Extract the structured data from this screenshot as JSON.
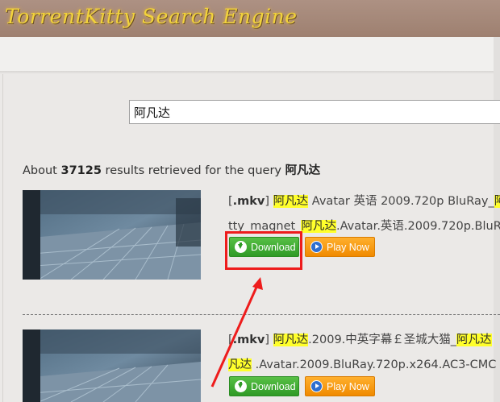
{
  "header": {
    "logo": "TorrentKitty Search Engine"
  },
  "search": {
    "query": "阿凡达"
  },
  "summary": {
    "prefix": "About ",
    "count": "37125",
    "middle": " results retrieved for the query ",
    "query": "阿凡达"
  },
  "results": [
    {
      "ext": ".mkv",
      "title": {
        "a": "[",
        "b": "] ",
        "c": "阿凡达",
        "d": " Avatar 英语 2009.720p BluRay_",
        "e": "阿"
      },
      "magnet": {
        "a": "tty_magnet_",
        "b": "阿凡达",
        "c": ".Avatar.英语.2009.720p.BluR"
      },
      "download_label": "Download",
      "play_label": "Play Now"
    },
    {
      "ext": ".mkv",
      "title": {
        "a": "[",
        "b": "] ",
        "c": "阿凡达",
        "d": ".2009.中英字幕￡圣城大猫_",
        "e": "阿凡达"
      },
      "magnet": {
        "a": "",
        "b": "凡达",
        "c": " .Avatar.2009.BluRay.720p.x264.AC3-CMC"
      },
      "download_label": "Download",
      "play_label": "Play Now"
    }
  ],
  "colors": {
    "highlight": "#ffff2b",
    "download": "#3aa32f",
    "play": "#f7960f",
    "annotation": "#ee1c1c",
    "header": "#a68878"
  },
  "icons": [
    "download-icon",
    "play-icon"
  ]
}
